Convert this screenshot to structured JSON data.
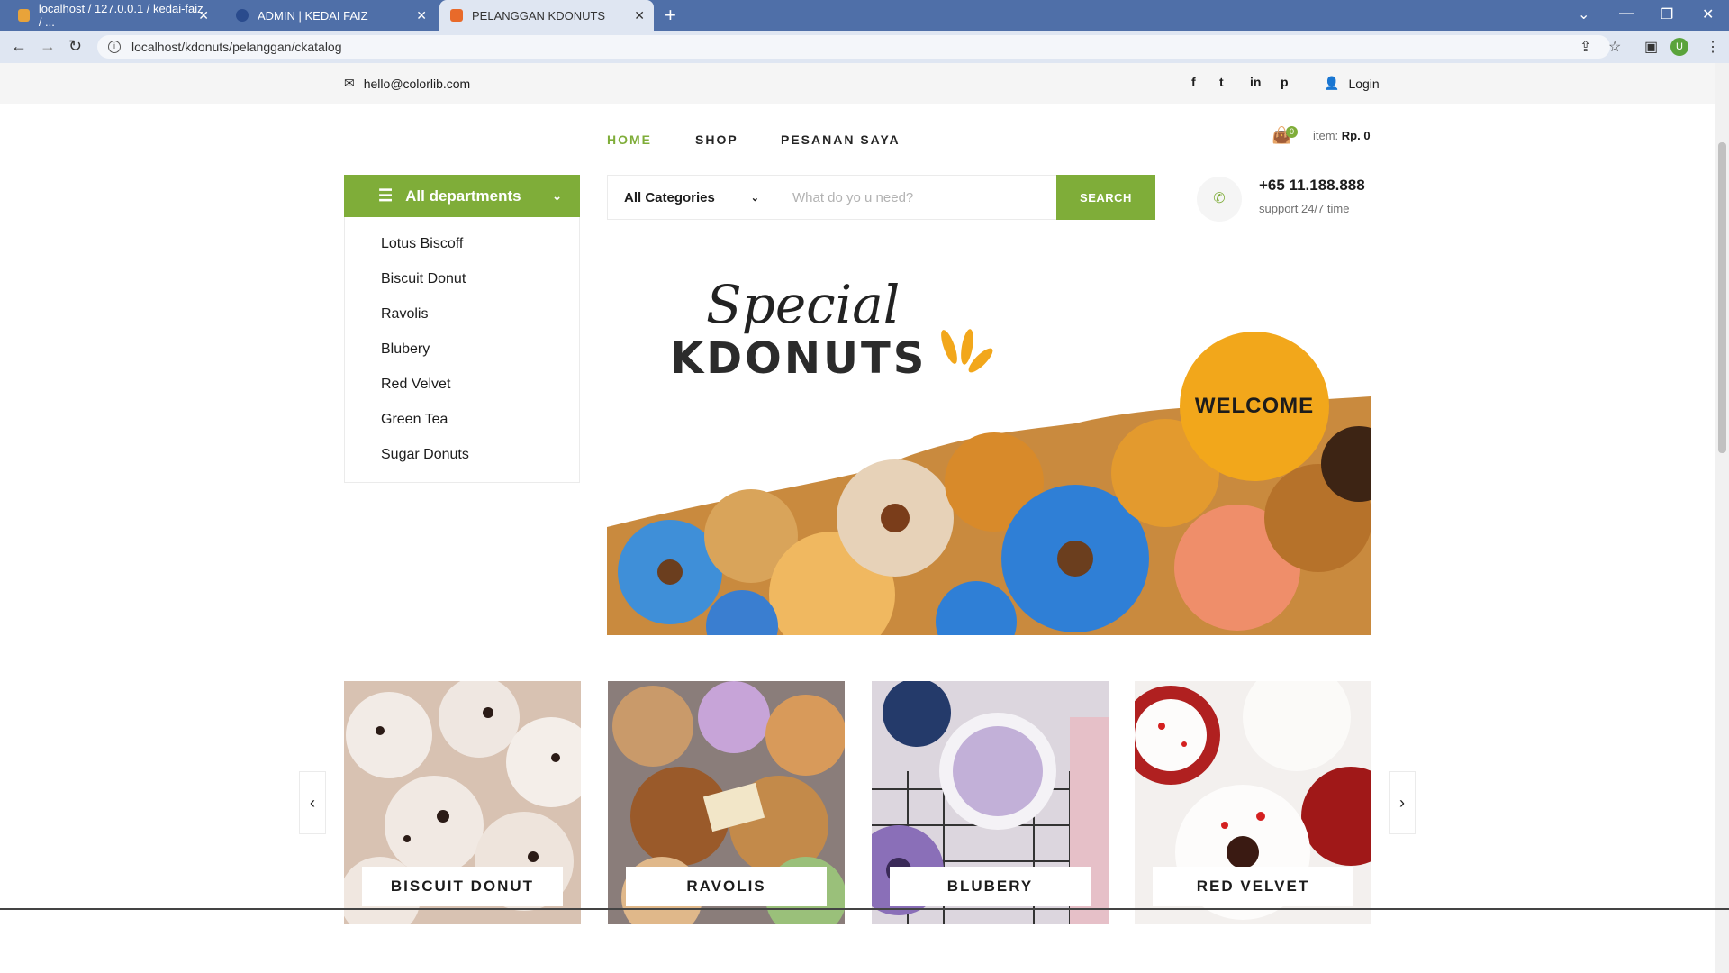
{
  "browser": {
    "tabs": [
      {
        "title": "localhost / 127.0.0.1 / kedai-faiz / ...",
        "color": "#e8a33a"
      },
      {
        "title": "ADMIN | KEDAI FAIZ",
        "color": "#2a4b8d"
      },
      {
        "title": "PELANGGAN KDONUTS",
        "color": "#e86a2a"
      }
    ],
    "url": "localhost/kdonuts/pelanggan/ckatalog",
    "profile_initial": "U"
  },
  "header": {
    "email": "hello@colorlib.com",
    "login": "Login",
    "nav": [
      "HOME",
      "SHOP",
      "PESANAN SAYA"
    ],
    "cart_count": "0",
    "item_label": "item:",
    "item_total": "Rp. 0"
  },
  "departments": {
    "title": "All departments",
    "items": [
      "Lotus Biscoff",
      "Biscuit Donut",
      "Ravolis",
      "Blubery",
      "Red Velvet",
      "Green Tea",
      "Sugar Donuts"
    ]
  },
  "search": {
    "category": "All Categories",
    "placeholder": "What do yo u need?",
    "button": "SEARCH"
  },
  "contact": {
    "phone": "+65 11.188.888",
    "support": "support 24/7 time"
  },
  "hero": {
    "script_text": "Special",
    "brand": "KDONUTS",
    "badge": "WELCOME"
  },
  "categories": [
    "BISCUIT DONUT",
    "RAVOLIS",
    "BLUBERY",
    "RED VELVET"
  ],
  "colors": {
    "accent": "#7fad39",
    "badge": "#f2a71b"
  }
}
